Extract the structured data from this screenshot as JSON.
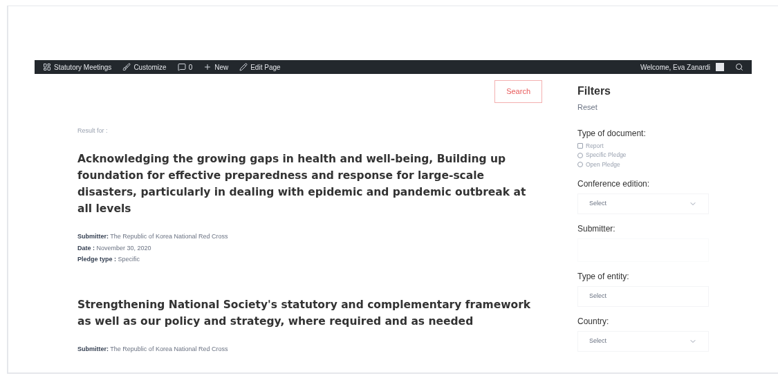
{
  "admin_bar": {
    "items": [
      {
        "kind": "dashboard",
        "label": "Statutory Meetings"
      },
      {
        "kind": "brush",
        "label": "Customize"
      },
      {
        "kind": "comment",
        "label": "0"
      },
      {
        "kind": "plus",
        "label": "New"
      },
      {
        "kind": "pencil",
        "label": "Edit Page"
      }
    ],
    "welcome": "Welcome, Eva Zanardi"
  },
  "search_button": "Search",
  "result_for": "Result for :",
  "results": [
    {
      "title": "Acknowledging the growing gaps in health and well-being, Building up foundation for effective preparedness and response for large-scale disasters, particularly in dealing with epidemic and pandemic outbreak at all levels",
      "meta": [
        {
          "label": "Submitter:",
          "value": "The Republic of Korea National Red Cross"
        },
        {
          "label": "Date :",
          "value": "November 30, 2020"
        },
        {
          "label": "Pledge type :",
          "value": "Specific"
        }
      ]
    },
    {
      "title": "Strengthening National Society's statutory and complementary framework as well as our policy and strategy, where required and as needed",
      "meta": [
        {
          "label": "Submitter:",
          "value": "The Republic of Korea National Red Cross"
        }
      ]
    }
  ],
  "filters": {
    "title": "Filters",
    "reset": "Reset",
    "document_type": {
      "label": "Type of document:",
      "options": [
        {
          "kind": "checkbox",
          "label": "Report",
          "checked": false
        },
        {
          "kind": "radio",
          "label": "Specific Pledge",
          "checked": false
        },
        {
          "kind": "radio",
          "label": "Open Pledge",
          "checked": false
        }
      ]
    },
    "fields": [
      {
        "label": "Conference edition:",
        "kind": "select",
        "placeholder": "Select",
        "caret": true
      },
      {
        "label": "Submitter:",
        "kind": "text"
      },
      {
        "label": "Type of entity:",
        "kind": "select",
        "placeholder": "Select",
        "caret": false
      },
      {
        "label": "Country:",
        "kind": "select",
        "placeholder": "Select",
        "caret": true
      }
    ]
  }
}
